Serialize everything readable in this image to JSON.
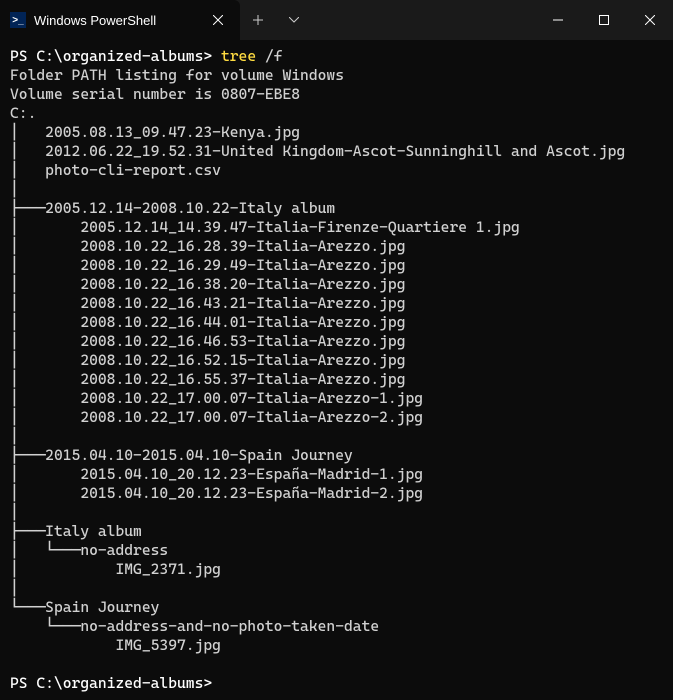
{
  "tab": {
    "title": "Windows PowerShell",
    "icon_label": ">_"
  },
  "prompt": {
    "path": "PS C:\\organized-albums>",
    "command": "tree",
    "args": "/f"
  },
  "output": {
    "l1": "Folder PATH listing for volume Windows",
    "l2": "Volume serial number is 0807-EBE8",
    "l3": "C:.",
    "l4": "│   2005.08.13_09.47.23-Kenya.jpg",
    "l5": "│   2012.06.22_19.52.31-United Kingdom-Ascot-Sunninghill and Ascot.jpg",
    "l6": "│   photo-cli-report.csv",
    "l7": "│",
    "l8": "├───2005.12.14-2008.10.22-Italy album",
    "l9": "│       2005.12.14_14.39.47-Italia-Firenze-Quartiere 1.jpg",
    "l10": "│       2008.10.22_16.28.39-Italia-Arezzo.jpg",
    "l11": "│       2008.10.22_16.29.49-Italia-Arezzo.jpg",
    "l12": "│       2008.10.22_16.38.20-Italia-Arezzo.jpg",
    "l13": "│       2008.10.22_16.43.21-Italia-Arezzo.jpg",
    "l14": "│       2008.10.22_16.44.01-Italia-Arezzo.jpg",
    "l15": "│       2008.10.22_16.46.53-Italia-Arezzo.jpg",
    "l16": "│       2008.10.22_16.52.15-Italia-Arezzo.jpg",
    "l17": "│       2008.10.22_16.55.37-Italia-Arezzo.jpg",
    "l18": "│       2008.10.22_17.00.07-Italia-Arezzo-1.jpg",
    "l19": "│       2008.10.22_17.00.07-Italia-Arezzo-2.jpg",
    "l20": "│",
    "l21": "├───2015.04.10-2015.04.10-Spain Journey",
    "l22": "│       2015.04.10_20.12.23-España-Madrid-1.jpg",
    "l23": "│       2015.04.10_20.12.23-España-Madrid-2.jpg",
    "l24": "│",
    "l25": "├───Italy album",
    "l26": "│   └───no-address",
    "l27": "│           IMG_2371.jpg",
    "l28": "│",
    "l29": "└───Spain Journey",
    "l30": "    └───no-address-and-no-photo-taken-date",
    "l31": "            IMG_5397.jpg"
  },
  "prompt2": {
    "path": "PS C:\\organized-albums>"
  }
}
